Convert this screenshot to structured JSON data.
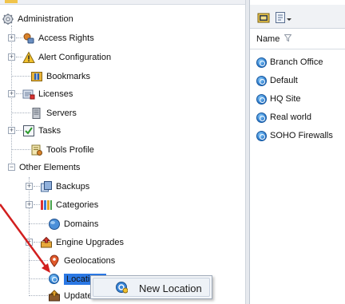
{
  "tree": {
    "root": {
      "label": "Administration",
      "icon": "gear-icon"
    },
    "items": [
      {
        "label": "Access Rights",
        "icon": "access-rights-icon",
        "expandable": true
      },
      {
        "label": "Alert Configuration",
        "icon": "warning-icon",
        "expandable": true
      },
      {
        "label": "Bookmarks",
        "icon": "bookmark-icon",
        "expandable": false
      },
      {
        "label": "Licenses",
        "icon": "license-icon",
        "expandable": true
      },
      {
        "label": "Servers",
        "icon": "server-icon",
        "expandable": false
      },
      {
        "label": "Tasks",
        "icon": "tasks-icon",
        "expandable": true
      },
      {
        "label": "Tools Profile",
        "icon": "tools-profile-icon",
        "expandable": false
      },
      {
        "label": "Other Elements",
        "icon": "",
        "expandable": true,
        "expanded": true
      }
    ],
    "other_elements": [
      {
        "label": "Backups",
        "icon": "backup-icon",
        "expandable": true
      },
      {
        "label": "Categories",
        "icon": "categories-icon",
        "expandable": true
      },
      {
        "label": "Domains",
        "icon": "domain-icon",
        "expandable": false
      },
      {
        "label": "Engine Upgrades",
        "icon": "engine-upgrade-icon",
        "expandable": true
      },
      {
        "label": "Geolocations",
        "icon": "geolocation-icon",
        "expandable": false
      },
      {
        "label": "Locations",
        "icon": "location-icon",
        "expandable": false,
        "selected": true
      },
      {
        "label": "Updates",
        "icon": "updates-icon",
        "expandable": false
      }
    ]
  },
  "right_pane": {
    "column_header": "Name",
    "items": [
      {
        "label": "Branch Office",
        "icon": "location-icon"
      },
      {
        "label": "Default",
        "icon": "location-icon"
      },
      {
        "label": "HQ Site",
        "icon": "location-icon"
      },
      {
        "label": "Real world",
        "icon": "location-icon"
      },
      {
        "label": "SOHO Firewalls",
        "icon": "location-icon"
      }
    ]
  },
  "context_menu": {
    "items": [
      {
        "label": "New Location",
        "icon": "location-icon"
      }
    ]
  },
  "colors": {
    "annotation_arrow": "#d21f1f",
    "selection": "#2b78e4"
  }
}
